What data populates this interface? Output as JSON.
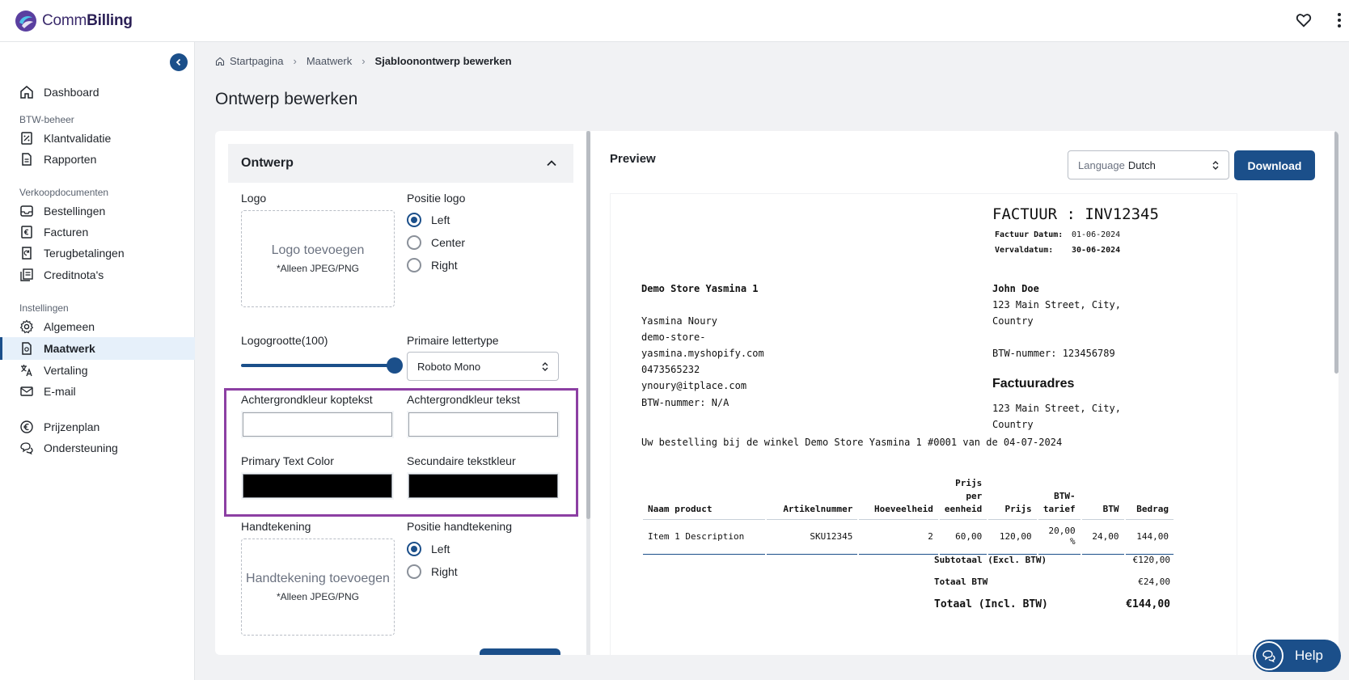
{
  "app": {
    "brand_light": "Comm",
    "brand_bold": "Billing"
  },
  "sidebar": {
    "items": [
      {
        "label": "Dashboard",
        "icon": "home-icon"
      },
      {
        "label": "Klantvalidatie",
        "icon": "percent-doc-icon"
      },
      {
        "label": "Rapporten",
        "icon": "document-icon"
      },
      {
        "label": "Bestellingen",
        "icon": "inbox-icon"
      },
      {
        "label": "Facturen",
        "icon": "euro-doc-icon"
      },
      {
        "label": "Terugbetalingen",
        "icon": "refund-icon"
      },
      {
        "label": "Creditnota's",
        "icon": "credit-note-icon"
      },
      {
        "label": "Algemeen",
        "icon": "gear-icon"
      },
      {
        "label": "Maatwerk",
        "icon": "custom-doc-icon"
      },
      {
        "label": "Vertaling",
        "icon": "translate-icon"
      },
      {
        "label": "E-mail",
        "icon": "mail-icon"
      },
      {
        "label": "Prijzenplan",
        "icon": "euro-circle-icon"
      },
      {
        "label": "Ondersteuning",
        "icon": "chat-icon"
      }
    ],
    "sections": [
      "BTW-beheer",
      "Verkoopdocumenten",
      "Instellingen"
    ]
  },
  "breadcrumb": {
    "home": "Startpagina",
    "level2": "Maatwerk",
    "current": "Sjabloonontwerp bewerken"
  },
  "page": {
    "title": "Ontwerp bewerken"
  },
  "design": {
    "section_title": "Ontwerp",
    "logo_label": "Logo",
    "logo_drop_title": "Logo toevoegen",
    "logo_drop_sub": "*Alleen JPEG/PNG",
    "logo_position_label": "Positie logo",
    "logo_positions": [
      "Left",
      "Center",
      "Right"
    ],
    "logo_size_label": "Logogrootte(100)",
    "logo_size_value": 100,
    "font_label": "Primaire lettertype",
    "font_value": "Roboto Mono",
    "bg_header_label": "Achtergrondkleur koptekst",
    "bg_text_label": "Achtergrondkleur tekst",
    "primary_text_label": "Primary Text Color",
    "secondary_text_label": "Secundaire tekstkleur",
    "signature_label": "Handtekening",
    "signature_drop_title": "Handtekening toevoegen",
    "signature_drop_sub": "*Alleen JPEG/PNG",
    "signature_position_label": "Positie handtekening",
    "signature_positions": [
      "Left",
      "Right"
    ]
  },
  "preview": {
    "title": "Preview",
    "language_label": "Language",
    "language_value": "Dutch",
    "download_label": "Download"
  },
  "invoice": {
    "title": "FACTUUR : INV12345",
    "date_label": "Factuur Datum:",
    "date_value": "01-06-2024",
    "due_label": "Vervaldatum:",
    "due_value": "30-06-2024",
    "store_name": "Demo Store Yasmina 1",
    "seller_lines": [
      "Yasmina Noury",
      "demo-store-",
      "yasmina.myshopify.com",
      "0473565232",
      "ynoury@itplace.com",
      "BTW-nummer: N/A"
    ],
    "customer_name": "John Doe",
    "customer_lines": [
      "123 Main Street, City,",
      "Country"
    ],
    "customer_vat": "BTW-nummer: 123456789",
    "billing_heading": "Factuuradres",
    "billing_lines": [
      "123 Main Street, City,",
      "Country"
    ],
    "order_note": "Uw bestelling bij de winkel Demo Store Yasmina 1 #0001 van de 04-07-2024",
    "columns": [
      "Naam product",
      "Artikelnummer",
      "Hoeveelheid",
      "Prijs per eenheid",
      "Prijs",
      "BTW- tarief",
      "BTW",
      "Bedrag"
    ],
    "rows": [
      [
        "Item 1 Description",
        "SKU12345",
        "2",
        "60,00",
        "120,00",
        "20,00 %",
        "24,00",
        "144,00"
      ]
    ],
    "subtotal_label": "Subtotaal (Excl. BTW)",
    "subtotal_value": "€120,00",
    "vat_total_label": "Totaal BTW",
    "vat_total_value": "€24,00",
    "total_label": "Totaal (Incl. BTW)",
    "total_value": "€144,00"
  },
  "help": {
    "label": "Help"
  },
  "colors": {
    "accent": "#1b4f8a",
    "highlight": "#8c3fa3",
    "active_bg": "#e6f0fa"
  }
}
